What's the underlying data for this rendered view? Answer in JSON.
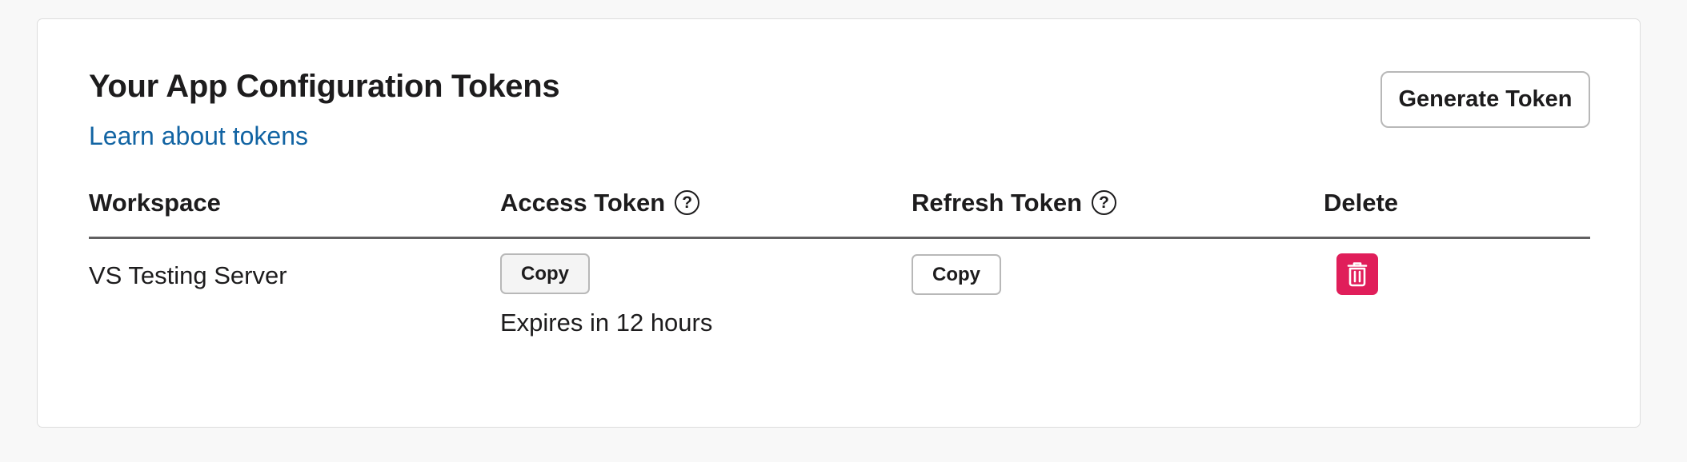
{
  "header": {
    "title": "Your App Configuration Tokens",
    "learn_link": "Learn about tokens",
    "generate_button": "Generate Token"
  },
  "table": {
    "columns": {
      "workspace": "Workspace",
      "access_token": "Access Token",
      "refresh_token": "Refresh Token",
      "delete": "Delete"
    },
    "help_glyph": "?",
    "rows": [
      {
        "workspace": "VS Testing Server",
        "access_copy_label": "Copy",
        "access_expiry": "Expires in 12 hours",
        "refresh_copy_label": "Copy",
        "delete_icon": "trash-icon"
      }
    ]
  },
  "colors": {
    "link": "#1264a3",
    "delete": "#e01e5a",
    "text": "#1d1c1d"
  }
}
